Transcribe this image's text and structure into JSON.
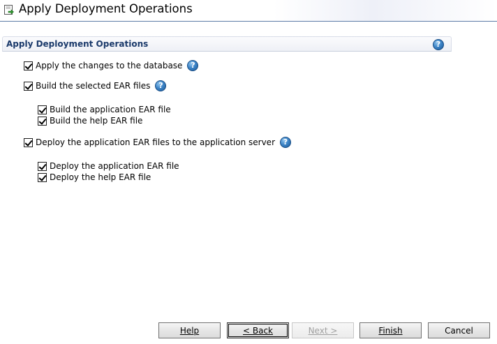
{
  "window": {
    "title": "Apply Deployment Operations",
    "icon": "wizard-icon"
  },
  "section": {
    "title": "Apply Deployment Operations",
    "help_icon": "?"
  },
  "options": {
    "apply_db": {
      "label": "Apply the changes to the database",
      "checked": true
    },
    "build_ear": {
      "label": "Build the selected EAR files",
      "checked": true
    },
    "build_app_ear": {
      "label": "Build the application EAR file",
      "checked": true
    },
    "build_help_ear": {
      "label": "Build the help EAR file",
      "checked": true
    },
    "deploy_ear": {
      "label": "Deploy the application EAR files to the application server",
      "checked": true
    },
    "deploy_app_ear": {
      "label": "Deploy the application EAR file",
      "checked": true
    },
    "deploy_help_ear": {
      "label": "Deploy the help EAR file",
      "checked": true
    }
  },
  "buttons": {
    "help": "Help",
    "back": "< Back",
    "next": "Next >",
    "finish": "Finish",
    "cancel": "Cancel"
  },
  "colors": {
    "section_title": "#1b3a6b",
    "help_icon": "#3f86c8",
    "title_border": "#5c7ba6"
  }
}
